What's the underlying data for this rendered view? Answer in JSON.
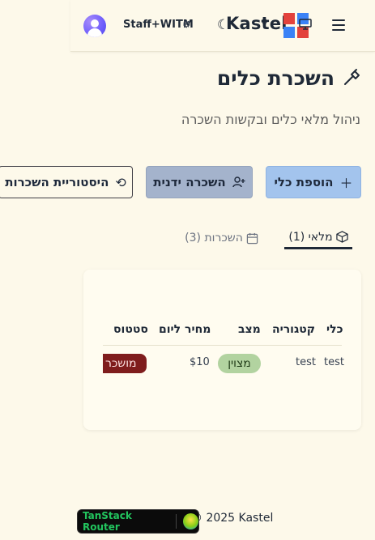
{
  "header": {
    "user_name": "Staff+WITM",
    "brand": "Kastel",
    "brand_colors": [
      "#e3423c",
      "#3b82f6"
    ]
  },
  "page": {
    "title": "השכרת כלים",
    "subtitle": "ניהול מלאי כלים ובקשות השכרה"
  },
  "actions": {
    "add_tool": "הוספת כלי",
    "manual_rental": "השכרה ידנית",
    "rental_history": "היסטוריית השכרות"
  },
  "tabs": {
    "inventory": "מלאי (1)",
    "rentals": "השכרות (3)"
  },
  "table": {
    "headers": {
      "tool": "כלי",
      "category": "קטגוריה",
      "condition": "מצב",
      "price_per_day": "מחיר ליום",
      "status": "סטטוס"
    },
    "rows": [
      {
        "tool": "test",
        "category": "test",
        "condition": "מצוין",
        "price_per_day": "$10",
        "status": "מושכר"
      }
    ]
  },
  "footer": {
    "copyright": "© 2025 Kastel",
    "devtools": "TanStack Router"
  },
  "colors": {
    "background": "#fdf9ea",
    "add_button": "#a3c4ed",
    "manual_button": "#a4b3cc",
    "badge_good": "#b2d3a0",
    "badge_rented": "#7f1d1d"
  }
}
